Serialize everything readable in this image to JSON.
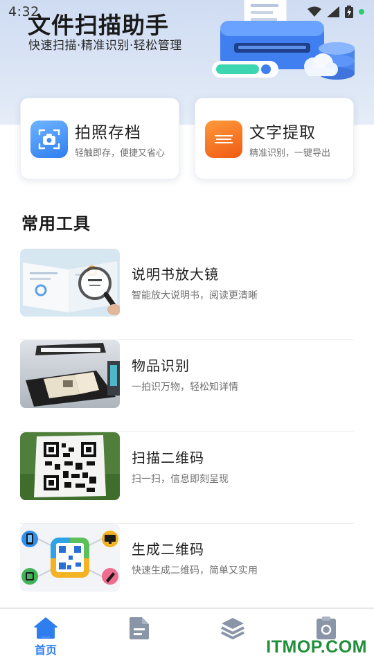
{
  "status_bar": {
    "time": "4:32"
  },
  "header": {
    "title": "文件扫描助手",
    "subtitle": "快速扫描·精准识别·轻松管理"
  },
  "features": [
    {
      "title": "拍照存档",
      "desc": "轻触即存，便捷又省心",
      "icon": "camera-icon",
      "color": "#3d8ef5"
    },
    {
      "title": "文字提取",
      "desc": "精准识别，一键导出",
      "icon": "text-lines-icon",
      "color": "#f2661e"
    }
  ],
  "tools_section": {
    "title": "常用工具",
    "items": [
      {
        "title": "说明书放大镜",
        "desc": "智能放大说明书，阅读更清晰",
        "thumb": "magnifier-manual-image"
      },
      {
        "title": "物品识别",
        "desc": "一拍识万物，轻松知详情",
        "thumb": "scanner-book-image"
      },
      {
        "title": "扫描二维码",
        "desc": "扫一扫，信息即刻呈现",
        "thumb": "qr-code-grass-image"
      },
      {
        "title": "生成二维码",
        "desc": "快速生成二维码，简单又实用",
        "thumb": "qr-devices-image"
      }
    ]
  },
  "bottom_nav": {
    "items": [
      {
        "label": "首页",
        "icon": "home-icon",
        "active": true
      },
      {
        "label": "",
        "icon": "document-icon",
        "active": false
      },
      {
        "label": "",
        "icon": "layers-icon",
        "active": false
      },
      {
        "label": "",
        "icon": "clipboard-icon",
        "active": false
      }
    ]
  },
  "watermark": "ITMOP.COM",
  "colors": {
    "accent": "#2f7ef0",
    "nav_inactive": "#8a96a8",
    "hero_bg": "#d6e2f4"
  }
}
